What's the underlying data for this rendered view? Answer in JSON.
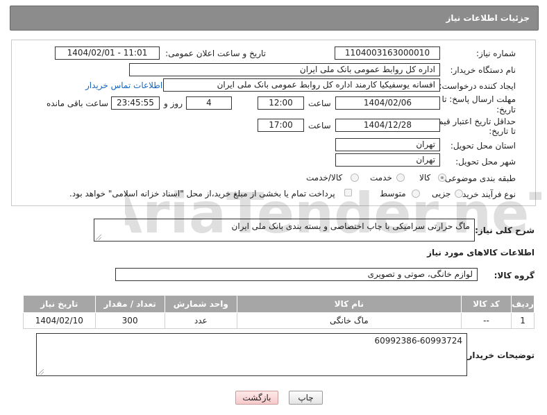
{
  "header": {
    "title": "جزئیات اطلاعات نیاز"
  },
  "form": {
    "need_number_label": "شماره نیاز:",
    "need_number": "1104003163000010",
    "announce_label": "تاریخ و ساعت اعلان عمومی:",
    "announce_value": "1404/02/01 - 11:01",
    "buyer_org_label": "نام دستگاه خریدار:",
    "buyer_org": "اداره کل روابط عمومی بانک ملی ایران",
    "creator_label": "ایجاد کننده درخواست:",
    "creator": "افسانه یوسفیکیا کارمند اداره کل روابط عمومی بانک ملی ایران",
    "contact_link": "اطلاعات تماس خریدار",
    "deadline_label_1": "مهلت ارسال پاسخ: تا",
    "deadline_label_2": "تاریخ:",
    "deadline_date": "1404/02/06",
    "time_word": "ساعت",
    "deadline_time": "12:00",
    "days_count": "4",
    "days_word": "روز و",
    "remaining_time": "23:45:55",
    "remaining_word": "ساعت باقی مانده",
    "min_validity_label_1": "حداقل تاریخ اعتبار قیمت:",
    "min_validity_label_2": "تا تاریخ:",
    "validity_date": "1404/12/28",
    "validity_time": "17:00",
    "province_label": "استان محل تحویل:",
    "province": "تهران",
    "city_label": "شهر محل تحویل:",
    "city": "تهران",
    "category_label": "طبقه بندی موضوعی:",
    "category_options": [
      "کالا",
      "خدمت",
      "کالا/خدمت"
    ],
    "category_selected": "کالا",
    "process_label": "نوع فرآیند خرید :",
    "process_options": [
      "جزیی",
      "متوسط"
    ],
    "payment_note": "پرداخت تمام یا بخشی از مبلغ خرید،از محل \"اسناد خزانه اسلامی\" خواهد بود."
  },
  "description": {
    "label": "شرح کلی نیاز:",
    "value": "ماگ حرارتی سرامیکی با چاپ اختصاصی و بسته بندی بانک ملی ایران"
  },
  "goods": {
    "section_title": "اطلاعات کالاهای مورد نیاز",
    "group_label": "گروه کالا:",
    "group_value": "لوازم خانگی، صوتی و تصویری",
    "columns": [
      "ردیف",
      "کد کالا",
      "نام کالا",
      "واحد شمارش",
      "تعداد / مقدار",
      "تاریخ نیاز"
    ],
    "rows": [
      {
        "row": "1",
        "code": "--",
        "name": "ماگ خانگی",
        "unit": "عدد",
        "qty": "300",
        "date": "1404/02/10"
      }
    ]
  },
  "buyer_notes": {
    "label": "توضیحات خریدار:",
    "value": "60992386-60993724"
  },
  "buttons": {
    "print": "چاپ",
    "back": "بازگشت"
  },
  "watermark_text": "AriaTender.neT",
  "colors": {
    "header_bg": "#8c8c8c",
    "table_header_bg": "#a6a6a6",
    "link": "#1565c0",
    "back_button": "#f6caca"
  }
}
